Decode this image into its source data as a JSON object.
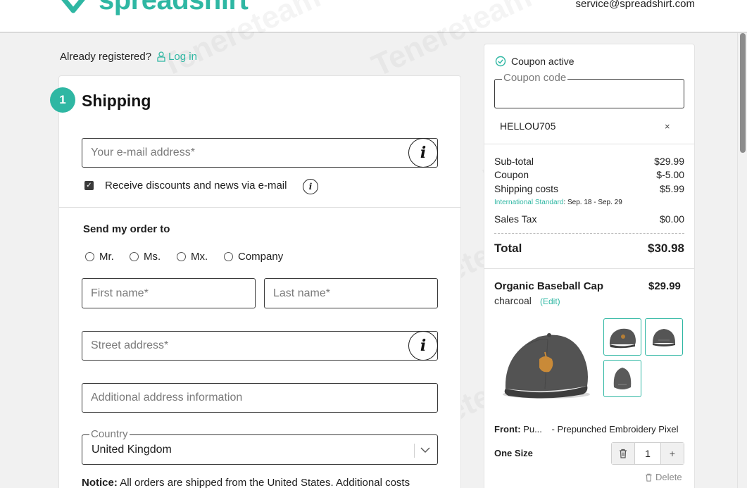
{
  "header": {
    "brand": "spreadshirt",
    "service_email": "service@spreadshirt.com",
    "colors": {
      "accent": "#2fb7a3"
    }
  },
  "account": {
    "already_registered": "Already registered?",
    "login_label": "Log in"
  },
  "shipping": {
    "step_number": "1",
    "title": "Shipping",
    "email_placeholder": "Your e-mail address*",
    "newsletter_label": "Receive discounts and news via e-mail",
    "newsletter_checked": true,
    "send_to_title": "Send my order to",
    "salutations": [
      "Mr.",
      "Ms.",
      "Mx.",
      "Company"
    ],
    "first_name_placeholder": "First name*",
    "last_name_placeholder": "Last name*",
    "street_placeholder": "Street address*",
    "additional_placeholder": "Additional address information",
    "country_label": "Country",
    "country_value": "United Kingdom",
    "notice_label": "Notice:",
    "notice_text": "All orders are shipped from the United States. Additional costs"
  },
  "summary": {
    "coupon_status": "Coupon active",
    "coupon_label": "Coupon code",
    "coupon_applied": "HELLOU705",
    "coupon_remove": "×",
    "subtotal_label": "Sub-total",
    "subtotal_value": "$29.99",
    "coupon_row_label": "Coupon",
    "coupon_row_value": "$-5.00",
    "shipping_label": "Shipping costs",
    "shipping_value": "$5.99",
    "shipping_method": "International Standard",
    "shipping_dates": ": Sep. 18 - Sep. 29",
    "tax_label": "Sales Tax",
    "tax_value": "$0.00",
    "total_label": "Total",
    "total_value": "$30.98"
  },
  "product": {
    "name": "Organic Baseball Cap",
    "price": "$29.99",
    "color": "charcoal",
    "edit_label": "(Edit)",
    "front_label": "Front:",
    "front_value": "Pu...",
    "design_text": "- Prepunched Embroidery Pixel",
    "size": "One Size",
    "quantity": "1",
    "delete_label": "Delete"
  },
  "watermark": "Tenereteam"
}
